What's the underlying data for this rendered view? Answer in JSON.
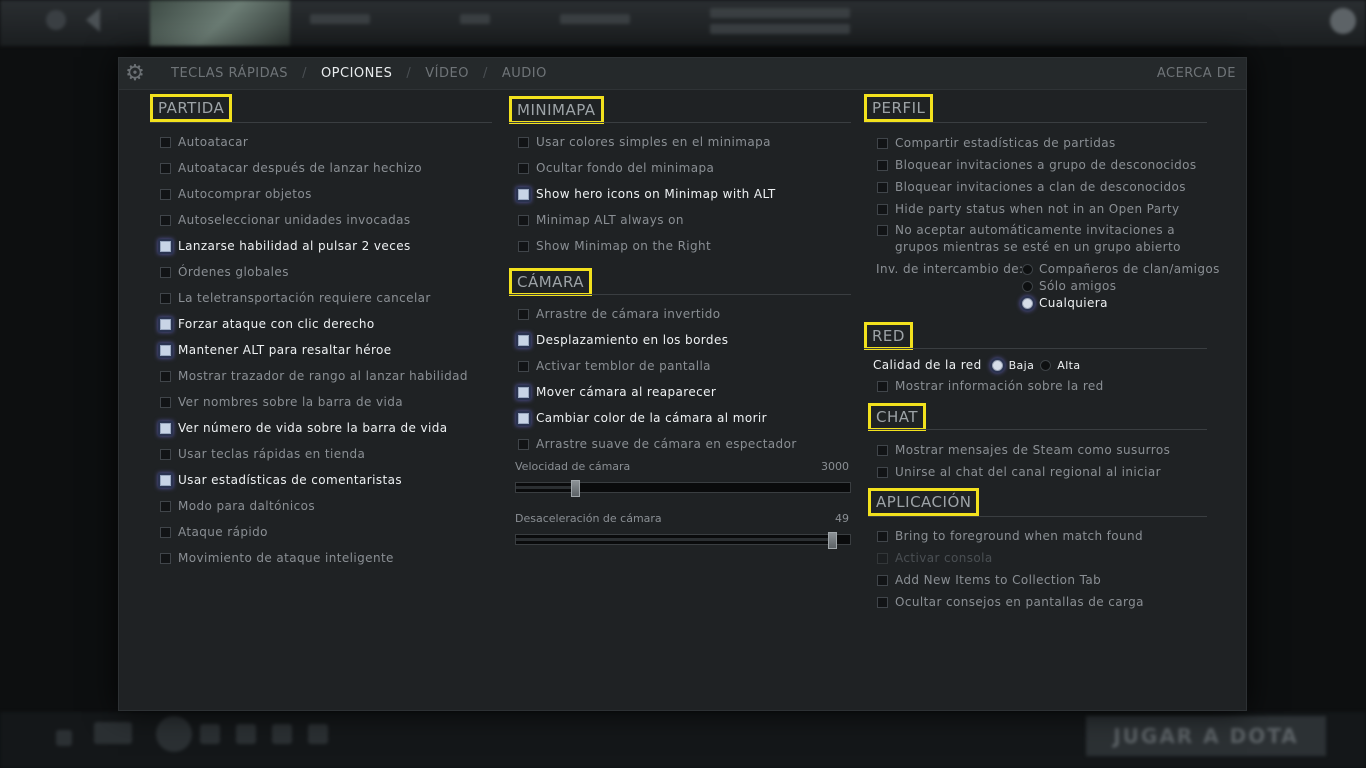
{
  "tabs": [
    "TECLAS RÁPIDAS",
    "OPCIONES",
    "VÍDEO",
    "AUDIO"
  ],
  "active_tab": "OPCIONES",
  "about_label": "ACERCA DE",
  "play_button": "JUGAR A DOTA",
  "partida": {
    "title": "PARTIDA",
    "options": [
      {
        "label": "Autoatacar",
        "checked": false
      },
      {
        "label": "Autoatacar después de lanzar hechizo",
        "checked": false
      },
      {
        "label": "Autocomprar objetos",
        "checked": false
      },
      {
        "label": "Autoseleccionar unidades invocadas",
        "checked": false
      },
      {
        "label": "Lanzarse habilidad al pulsar 2 veces",
        "checked": true
      },
      {
        "label": "Órdenes globales",
        "checked": false
      },
      {
        "label": "La teletransportación requiere cancelar",
        "checked": false
      },
      {
        "label": "Forzar ataque con clic derecho",
        "checked": true
      },
      {
        "label": "Mantener ALT para resaltar héroe",
        "checked": true
      },
      {
        "label": "Mostrar trazador de rango al lanzar habilidad",
        "checked": false
      },
      {
        "label": "Ver nombres sobre la barra de vida",
        "checked": false
      },
      {
        "label": "Ver número de vida sobre la barra de vida",
        "checked": true
      },
      {
        "label": "Usar teclas rápidas en tienda",
        "checked": false
      },
      {
        "label": "Usar estadísticas de comentaristas",
        "checked": true
      },
      {
        "label": "Modo para daltónicos",
        "checked": false
      },
      {
        "label": "Ataque rápido",
        "checked": false
      },
      {
        "label": "Movimiento de ataque inteligente",
        "checked": false
      }
    ]
  },
  "minimapa": {
    "title": "MINIMAPA",
    "options": [
      {
        "label": "Usar colores simples en el minimapa",
        "checked": false
      },
      {
        "label": "Ocultar fondo del minimapa",
        "checked": false
      },
      {
        "label": "Show hero icons on Minimap with ALT",
        "checked": true
      },
      {
        "label": "Minimap ALT always on",
        "checked": false
      },
      {
        "label": "Show Minimap on the Right",
        "checked": false
      }
    ]
  },
  "camara": {
    "title": "CÁMARA",
    "options": [
      {
        "label": "Arrastre de cámara invertido",
        "checked": false
      },
      {
        "label": "Desplazamiento en los bordes",
        "checked": true
      },
      {
        "label": "Activar temblor de pantalla",
        "checked": false
      },
      {
        "label": "Mover cámara al reaparecer",
        "checked": true
      },
      {
        "label": "Cambiar color de la cámara al morir",
        "checked": true
      },
      {
        "label": "Arrastre suave de cámara en espectador",
        "checked": false
      }
    ],
    "speed": {
      "label": "Velocidad de cámara",
      "value": "3000",
      "fraction": 0.17
    },
    "decel": {
      "label": "Desaceleración de cámara",
      "value": "49",
      "fraction": 0.96
    }
  },
  "perfil": {
    "title": "PERFIL",
    "options": [
      {
        "label": "Compartir estadísticas de partidas",
        "checked": false
      },
      {
        "label": "Bloquear invitaciones a grupo de desconocidos",
        "checked": false
      },
      {
        "label": "Bloquear invitaciones a clan de desconocidos",
        "checked": false
      },
      {
        "label": "Hide party status when not in an Open Party",
        "checked": false
      }
    ],
    "auto_decline": {
      "label": "No aceptar automáticamente invitaciones a grupos mientras se esté en un grupo abierto",
      "checked": false
    },
    "trade": {
      "label": "Inv. de intercambio de:",
      "choices": [
        {
          "label": "Compañeros de clan/amigos",
          "selected": false
        },
        {
          "label": "Sólo amigos",
          "selected": false
        },
        {
          "label": "Cualquiera",
          "selected": true
        }
      ]
    }
  },
  "red": {
    "title": "RED",
    "quality_label": "Calidad de la red",
    "quality_choices": [
      {
        "label": "Baja",
        "selected": true
      },
      {
        "label": "Alta",
        "selected": false
      }
    ],
    "options": [
      {
        "label": "Mostrar información sobre la red",
        "checked": false
      }
    ]
  },
  "chat": {
    "title": "CHAT",
    "options": [
      {
        "label": "Mostrar mensajes de Steam como susurros",
        "checked": false
      },
      {
        "label": "Unirse al chat del canal regional al iniciar",
        "checked": false
      }
    ]
  },
  "aplicacion": {
    "title": "APLICACIÓN",
    "options": [
      {
        "label": "Bring to foreground when match found",
        "checked": false,
        "disabled": false
      },
      {
        "label": "Activar consola",
        "checked": false,
        "disabled": true
      },
      {
        "label": "Add New Items to Collection Tab",
        "checked": false,
        "disabled": false
      },
      {
        "label": "Ocultar consejos en pantallas de carga",
        "checked": false,
        "disabled": false
      }
    ]
  }
}
